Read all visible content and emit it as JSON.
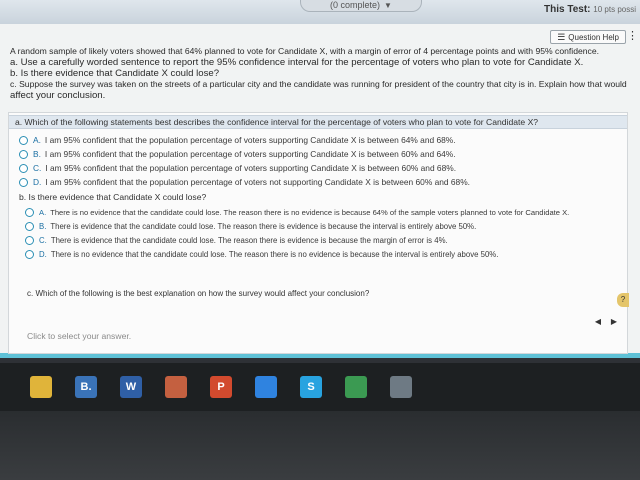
{
  "header": {
    "progress_text": "(0 complete)",
    "test_label": "This Test:",
    "test_points": "10 pts possi"
  },
  "toolbar": {
    "help_label": "Question Help"
  },
  "question": {
    "intro": "A random sample of likely voters showed that 64% planned to vote for Candidate X, with a margin of error of 4 percentage points and with 95% confidence.",
    "part_a": "a. Use a carefully worded sentence to report the 95% confidence interval for the percentage of voters who plan to vote for Candidate X.",
    "part_b": "b. Is there evidence that Candidate X could lose?",
    "part_c_line1": "c. Suppose the survey was taken on the streets of a particular city and the candidate was running for president of the country that city is in. Explain how that would",
    "part_c_line2": "affect your conclusion."
  },
  "parts": {
    "a": {
      "prompt": "a. Which of the following statements best describes the confidence interval for the percentage of voters who plan to vote for Candidate X?",
      "options": [
        {
          "letter": "A.",
          "text": "I am 95% confident that the population percentage of voters supporting Candidate X is between 64% and 68%."
        },
        {
          "letter": "B.",
          "text": "I am 95% confident that the population percentage of voters supporting Candidate X is between 60% and 64%."
        },
        {
          "letter": "C.",
          "text": "I am 95% confident that the population percentage of voters supporting Candidate X is between 60% and 68%."
        },
        {
          "letter": "D.",
          "text": "I am 95% confident that the population percentage of voters not supporting Candidate X is between 60% and 68%."
        }
      ]
    },
    "b": {
      "prompt": "b. Is there evidence that Candidate X could lose?",
      "options": [
        {
          "letter": "A.",
          "text": "There is no evidence that the candidate could lose. The reason there is no evidence is because 64% of the sample voters planned to vote for Candidate X."
        },
        {
          "letter": "B.",
          "text": "There is evidence that the candidate could lose. The reason there is evidence is because the interval is entirely above 50%."
        },
        {
          "letter": "C.",
          "text": "There is evidence that the candidate could lose. The reason there is evidence is because the margin of error is 4%."
        },
        {
          "letter": "D.",
          "text": "There is no evidence that the candidate could lose. The reason there is no evidence is because the interval is entirely above 50%."
        }
      ]
    },
    "c": {
      "prompt": "c. Which of the following is the best explanation on how the survey would affect your conclusion?"
    }
  },
  "answer": {
    "placeholder": "Click to select your answer."
  },
  "taskbar": {
    "apps": [
      {
        "icon": "file-explorer-icon",
        "label": "",
        "color": "#e0b43a"
      },
      {
        "icon": "blackboard-icon",
        "label": "B.",
        "color": "#3a73b8"
      },
      {
        "icon": "word-icon",
        "label": "W",
        "color": "#2f5fa6"
      },
      {
        "icon": "image-icon",
        "label": "",
        "color": "#c46040"
      },
      {
        "icon": "powerpoint-icon",
        "label": "P",
        "color": "#d24a2e"
      },
      {
        "icon": "dropbox-icon",
        "label": "",
        "color": "#2f83e0"
      },
      {
        "icon": "skype-icon",
        "label": "S",
        "color": "#28a3e0"
      },
      {
        "icon": "chrome-icon",
        "label": "",
        "color": "#3b9a52"
      },
      {
        "icon": "photos-icon",
        "label": "",
        "color": "#6e7a84"
      }
    ]
  },
  "colors": {
    "accent": "#2b8fb4",
    "sheet": "#f1f3f3",
    "border_accent": "#5ec1d6"
  }
}
